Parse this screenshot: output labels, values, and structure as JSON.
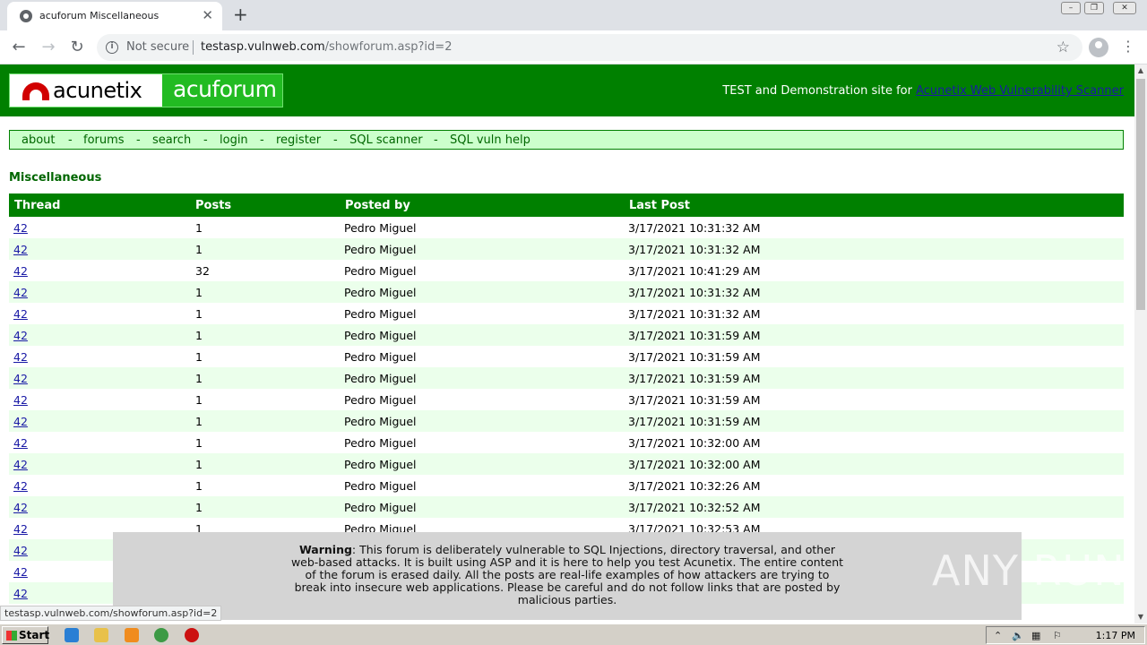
{
  "browser": {
    "tab_title": "acuforum Miscellaneous",
    "tab_close": "✕",
    "new_tab": "+",
    "not_secure": "Not secure",
    "url_host": "testasp.vulnweb.com",
    "url_path": "/showforum.asp?id=2",
    "status_url": "testasp.vulnweb.com/showforum.asp?id=2"
  },
  "site": {
    "logo_left": "acunetix",
    "logo_right": "acuforum",
    "tagline_prefix": "TEST and Demonstration site for",
    "tagline_link": "Acunetix Web Vulnerability Scanner"
  },
  "menu": [
    "about",
    "forums",
    "search",
    "login",
    "register",
    "SQL scanner",
    "SQL vuln help"
  ],
  "menu_separator": "-",
  "forum_title": "Miscellaneous",
  "table": {
    "headers": [
      "Thread",
      "Posts",
      "Posted by",
      "Last Post"
    ],
    "rows": [
      [
        "42",
        "1",
        "Pedro Miguel",
        "3/17/2021 10:31:32 AM"
      ],
      [
        "42",
        "1",
        "Pedro Miguel",
        "3/17/2021 10:31:32 AM"
      ],
      [
        "42",
        "32",
        "Pedro Miguel",
        "3/17/2021 10:41:29 AM"
      ],
      [
        "42",
        "1",
        "Pedro Miguel",
        "3/17/2021 10:31:32 AM"
      ],
      [
        "42",
        "1",
        "Pedro Miguel",
        "3/17/2021 10:31:32 AM"
      ],
      [
        "42",
        "1",
        "Pedro Miguel",
        "3/17/2021 10:31:59 AM"
      ],
      [
        "42",
        "1",
        "Pedro Miguel",
        "3/17/2021 10:31:59 AM"
      ],
      [
        "42",
        "1",
        "Pedro Miguel",
        "3/17/2021 10:31:59 AM"
      ],
      [
        "42",
        "1",
        "Pedro Miguel",
        "3/17/2021 10:31:59 AM"
      ],
      [
        "42",
        "1",
        "Pedro Miguel",
        "3/17/2021 10:31:59 AM"
      ],
      [
        "42",
        "1",
        "Pedro Miguel",
        "3/17/2021 10:32:00 AM"
      ],
      [
        "42",
        "1",
        "Pedro Miguel",
        "3/17/2021 10:32:00 AM"
      ],
      [
        "42",
        "1",
        "Pedro Miguel",
        "3/17/2021 10:32:26 AM"
      ],
      [
        "42",
        "1",
        "Pedro Miguel",
        "3/17/2021 10:32:52 AM"
      ],
      [
        "42",
        "1",
        "Pedro Miguel",
        "3/17/2021 10:32:53 AM"
      ],
      [
        "42",
        "",
        "",
        ""
      ],
      [
        "42",
        "",
        "",
        ""
      ],
      [
        "42",
        "",
        "",
        ""
      ]
    ]
  },
  "warning": {
    "label": "Warning",
    "text": ": This forum is deliberately vulnerable to SQL Injections, directory traversal, and other web-based attacks. It is built using ASP and it is here to help you test Acunetix. The entire content of the forum is erased daily. All the posts are real-life examples of how attackers are trying to break into insecure web applications. Please be careful and do not follow links that are posted by malicious parties."
  },
  "watermark": "ANY RUN",
  "taskbar": {
    "start": "Start",
    "clock": "1:17 PM"
  },
  "colors": {
    "header_green": "#008000",
    "menu_bg": "#ccffcc",
    "row_alt": "#ebffeb",
    "link": "#1a1aa6"
  }
}
